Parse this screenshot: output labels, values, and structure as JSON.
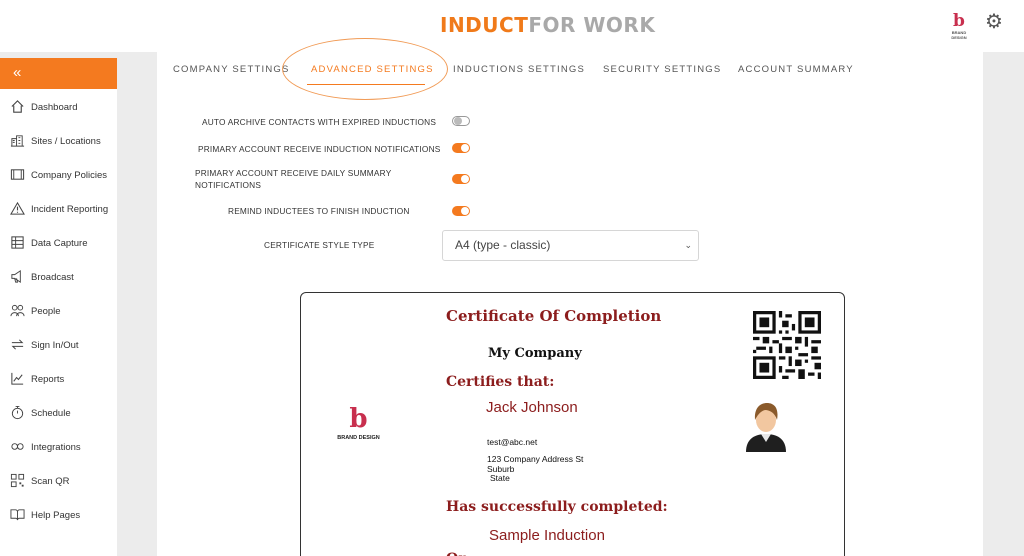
{
  "header": {
    "logo_part1": "INDUCT",
    "logo_part2": "FOR WORK",
    "brand_text": "BRAND DESIGN"
  },
  "sidebar": {
    "collapse_glyph": "«",
    "items": [
      {
        "label": "Dashboard",
        "icon": "home-icon"
      },
      {
        "label": "Sites / Locations",
        "icon": "buildings-icon"
      },
      {
        "label": "Company Policies",
        "icon": "book-icon"
      },
      {
        "label": "Incident Reporting",
        "icon": "warning-icon"
      },
      {
        "label": "Data Capture",
        "icon": "form-icon"
      },
      {
        "label": "Broadcast",
        "icon": "megaphone-icon"
      },
      {
        "label": "People",
        "icon": "people-icon"
      },
      {
        "label": "Sign In/Out",
        "icon": "swap-icon"
      },
      {
        "label": "Reports",
        "icon": "chart-icon"
      },
      {
        "label": "Schedule",
        "icon": "stopwatch-icon"
      },
      {
        "label": "Integrations",
        "icon": "link-icon"
      },
      {
        "label": "Scan QR",
        "icon": "qr-icon"
      },
      {
        "label": "Help Pages",
        "icon": "open-book-icon"
      }
    ]
  },
  "tabs": [
    {
      "label": "COMPANY SETTINGS",
      "active": false
    },
    {
      "label": "ADVANCED SETTINGS",
      "active": true
    },
    {
      "label": "INDUCTIONS SETTINGS",
      "active": false
    },
    {
      "label": "SECURITY SETTINGS",
      "active": false
    },
    {
      "label": "ACCOUNT SUMMARY",
      "active": false
    }
  ],
  "settings": {
    "auto_archive": {
      "label": "AUTO ARCHIVE CONTACTS WITH EXPIRED INDUCTIONS",
      "enabled": false
    },
    "induction_notifications": {
      "label": "PRIMARY ACCOUNT RECEIVE INDUCTION NOTIFICATIONS",
      "enabled": true
    },
    "daily_summary": {
      "label_line1": "PRIMARY ACCOUNT RECEIVE DAILY SUMMARY",
      "label_line2": "NOTIFICATIONS",
      "enabled": true
    },
    "remind_inductees": {
      "label": "REMIND INDUCTEES TO FINISH INDUCTION",
      "enabled": true
    },
    "certificate_style": {
      "label": "CERTIFICATE STYLE TYPE",
      "value": "A4 (type - classic)"
    }
  },
  "certificate": {
    "title": "Certificate Of Completion",
    "company": "My Company",
    "certifies": "Certifies that:",
    "name": "Jack Johnson",
    "email": "test@abc.net",
    "address_line1": "123 Company Address St",
    "address_line2": "Suburb",
    "address_line3": "State",
    "completed_heading": "Has successfully completed:",
    "course": "Sample Induction",
    "logo_text": "BRAND DESIGN"
  },
  "colors": {
    "accent": "#f47a1f",
    "cert_heading": "#8c1d1d",
    "brand_mark": "#c82f4e"
  }
}
